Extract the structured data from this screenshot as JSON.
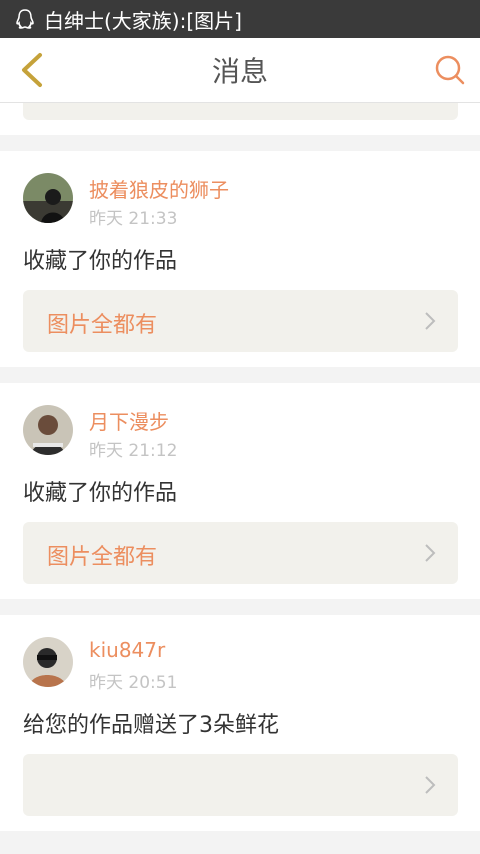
{
  "statusbar": {
    "notification": "白绅士(大家族):[图片]"
  },
  "header": {
    "title": "消息"
  },
  "messages": [
    {
      "name": "披着狼皮的狮子",
      "time": "昨天 21:33",
      "text": "收藏了你的作品",
      "work_title": "图片全都有"
    },
    {
      "name": "月下漫步",
      "time": "昨天 21:12",
      "text": "收藏了你的作品",
      "work_title": "图片全都有"
    },
    {
      "name": "kiu847r",
      "time": "昨天 20:51",
      "text": "给您的作品赠送了3朵鲜花",
      "work_title": ""
    }
  ],
  "colors": {
    "accent": "#ec8e5f",
    "muted": "#c4c4c4",
    "card_box": "#f2f1ec"
  }
}
